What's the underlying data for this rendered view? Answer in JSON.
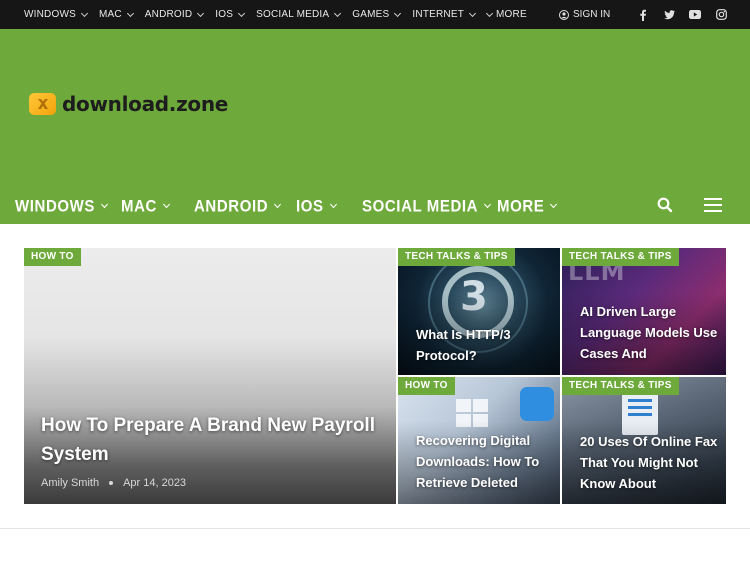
{
  "topbar": {
    "nav": [
      {
        "label": "WINDOWS"
      },
      {
        "label": "MAC"
      },
      {
        "label": "ANDROID"
      },
      {
        "label": "IOS"
      },
      {
        "label": "SOCIAL MEDIA"
      },
      {
        "label": "GAMES"
      },
      {
        "label": "INTERNET"
      }
    ],
    "more_label": "MORE",
    "signin_label": "SIGN IN",
    "socials": [
      "facebook-icon",
      "twitter-icon",
      "youtube-icon",
      "instagram-icon"
    ]
  },
  "header": {
    "logo_text": "download.zone",
    "accent_color": "#6ea93b"
  },
  "mainnav": {
    "items": [
      {
        "label": "WINDOWS"
      },
      {
        "label": "MAC"
      },
      {
        "label": "ANDROID"
      },
      {
        "label": "IOS"
      },
      {
        "label": "SOCIAL MEDIA"
      },
      {
        "label": "MORE"
      }
    ]
  },
  "featured": {
    "main": {
      "category": "HOW TO",
      "title": "How To Prepare A Brand New Payroll System",
      "author": "Amily Smith",
      "date": "Apr 14, 2023"
    },
    "side": [
      {
        "category": "TECH TALKS & TIPS",
        "title": "What Is HTTP/3 Protocol?"
      },
      {
        "category": "TECH TALKS & TIPS",
        "title": "AI Driven Large Language Models Use Cases And"
      },
      {
        "category": "HOW TO",
        "title": "Recovering Digital Downloads: How To Retrieve Deleted"
      },
      {
        "category": "TECH TALKS & TIPS",
        "title": "20 Uses Of Online Fax That You Might Not Know About"
      }
    ]
  }
}
